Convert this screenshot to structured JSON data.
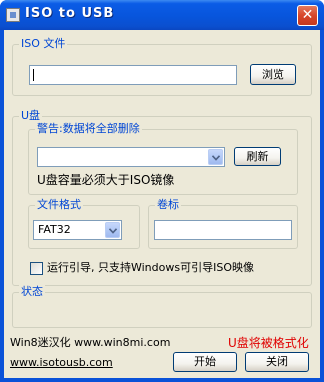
{
  "window": {
    "title": "ISO to USB",
    "close_symbol": "✕"
  },
  "iso_group": {
    "label": "ISO 文件",
    "path_value": "",
    "browse_label": "浏览"
  },
  "usb_group": {
    "label": "U盘",
    "warning_group_label": "警告:数据将全部删除",
    "drive_value": "",
    "refresh_label": "刷新",
    "capacity_note": "U盘容量必须大于ISO镜像"
  },
  "fs_group": {
    "label": "文件格式",
    "value": "FAT32"
  },
  "volume_group": {
    "label": "卷标",
    "value": ""
  },
  "bootable": {
    "checked": false,
    "label": "运行引导, 只支持Windows可引导ISO映像"
  },
  "status_group": {
    "label": "状态",
    "text": ""
  },
  "footer": {
    "credit": "Win8迷汉化 www.win8mi.com",
    "warning": "U盘将被格式化",
    "site_link": "www.isotousb.com",
    "start_label": "开始",
    "close_label": "关闭"
  },
  "colors": {
    "title_bar": "#0855dc",
    "dialog_bg": "#ece9d8",
    "group_label": "#0046d5",
    "format_warning": "#e00000"
  },
  "icons": {
    "app": "app-icon",
    "close": "close-icon",
    "dropdown": "chevron-down-icon"
  }
}
